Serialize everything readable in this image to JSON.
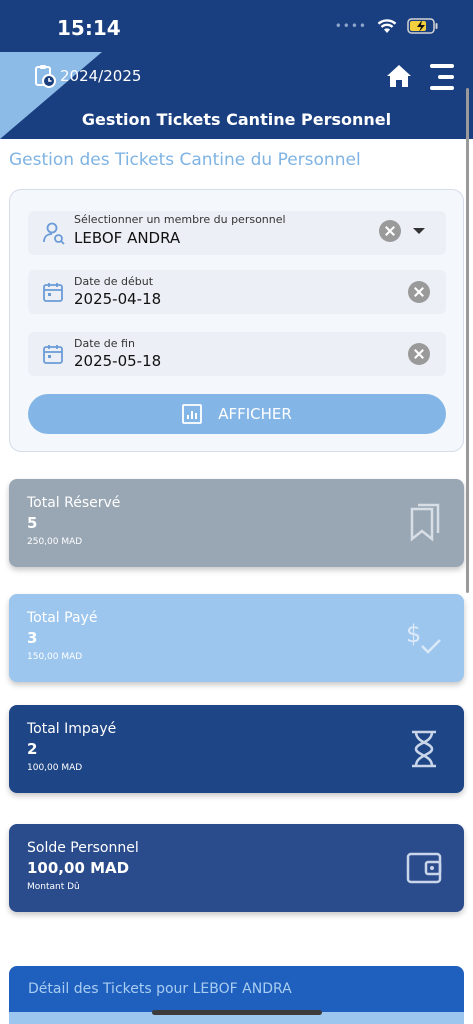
{
  "status_bar": {
    "time": "15:14"
  },
  "header": {
    "school_year": "2024/2025",
    "title": "Gestion Tickets Cantine Personnel"
  },
  "page": {
    "heading": "Gestion des Tickets Cantine du Personnel"
  },
  "filters": {
    "staff": {
      "label": "Sélectionner un membre du personnel",
      "value": "LEBOF ANDRA"
    },
    "start_date": {
      "label": "Date de début",
      "value": "2025-04-18"
    },
    "end_date": {
      "label": "Date de fin",
      "value": "2025-05-18"
    },
    "submit_label": "AFFICHER"
  },
  "stats": [
    {
      "title": "Total Réservé",
      "value": "5",
      "sub": "250,00 MAD",
      "color": "#99a6b4",
      "icon": "bookmarks-icon"
    },
    {
      "title": "Total Payé",
      "value": "3",
      "sub": "150,00 MAD",
      "color": "#9cc6ee",
      "icon": "dollar-check-icon"
    },
    {
      "title": "Total Impayé",
      "value": "2",
      "sub": "100,00 MAD",
      "color": "#1e4585",
      "icon": "hourglass-icon"
    },
    {
      "title": "Solde Personnel",
      "value": "100,00 MAD",
      "sub": "Montant Dû",
      "color": "#2a4c8c",
      "icon": "wallet-icon"
    }
  ],
  "detail": {
    "title": "Détail des Tickets pour LEBOF ANDRA"
  }
}
